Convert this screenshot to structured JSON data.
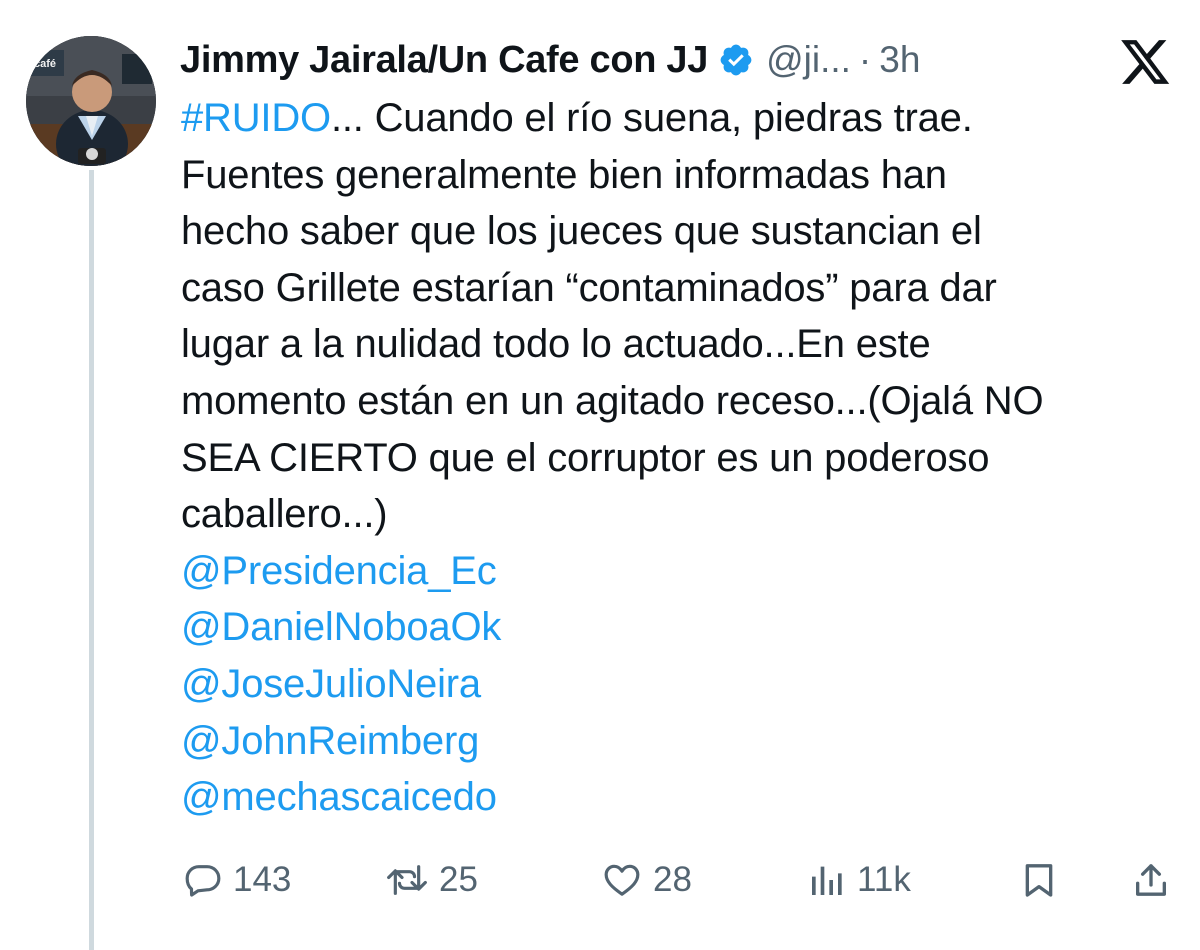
{
  "tweet": {
    "display_name": "Jimmy Jairala/Un Cafe con JJ",
    "handle": "@ji...",
    "separator": "·",
    "time": "3h",
    "avatar_text": "café",
    "body": {
      "hashtag": "#RUIDO",
      "first_line_rest": "... Cuando el río suena, piedras trae.",
      "lines": [
        "Fuentes generalmente bien informadas han",
        "hecho saber que los jueces que sustancian el",
        "caso Grillete estarían “contaminados” para dar",
        "lugar a la nulidad todo lo actuado...En este",
        "momento están en un agitado receso...(Ojalá NO",
        "SEA CIERTO que el corruptor es un poderoso",
        "caballero...)"
      ],
      "mentions": [
        "@Presidencia_Ec",
        "@DanielNoboaOk",
        "@JoseJulioNeira",
        "@JohnReimberg",
        "@mechascaicedo"
      ]
    },
    "metrics": {
      "replies": "143",
      "reposts": "25",
      "likes": "28",
      "views": "11k"
    }
  },
  "colors": {
    "text": "#0f1419",
    "secondary": "#536471",
    "link": "#1d9bf0",
    "verified": "#1d9bf0",
    "thread_line": "#cfd9de"
  },
  "icons": {
    "verified": "verified-badge-icon",
    "logo": "x-logo-icon",
    "reply": "reply-icon",
    "repost": "repost-icon",
    "like": "heart-icon",
    "views": "views-icon",
    "bookmark": "bookmark-icon",
    "share": "share-icon"
  }
}
